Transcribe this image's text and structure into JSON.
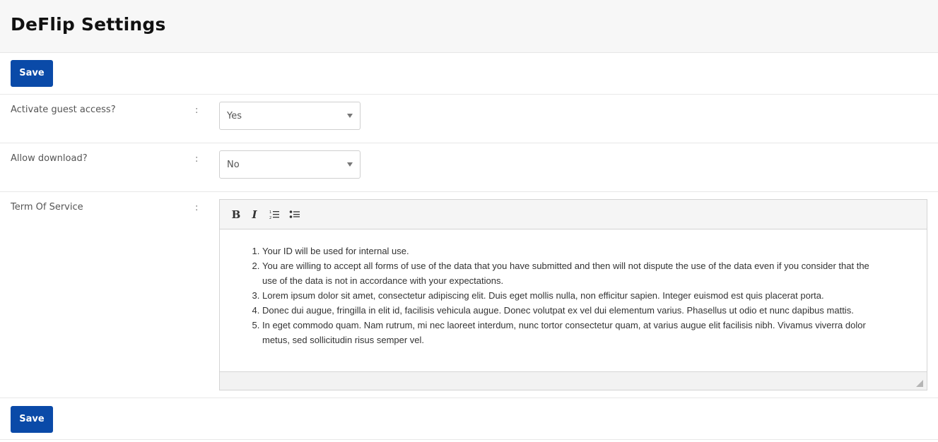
{
  "header": {
    "title": "DeFlip Settings"
  },
  "actions": {
    "save_label": "Save"
  },
  "fields": {
    "guest_access": {
      "label": "Activate guest access?",
      "separator": ":",
      "value": "Yes"
    },
    "allow_download": {
      "label": "Allow download?",
      "separator": ":",
      "value": "No"
    },
    "terms": {
      "label": "Term Of Service",
      "separator": ":"
    }
  },
  "editor": {
    "toolbar": {
      "bold": "B",
      "italic": "I",
      "ordered_list_icon": "ordered-list-icon",
      "bullet_list_icon": "bullet-list-icon"
    },
    "items": [
      "Your ID will be used for internal use.",
      "You are willing to accept all forms of use of the data that you have submitted and then will not dispute the use of the data even if you consider that the use of the data is not in accordance with your expectations.",
      "Lorem ipsum dolor sit amet, consectetur adipiscing elit. Duis eget mollis nulla, non efficitur sapien. Integer euismod est quis placerat porta.",
      "Donec dui augue, fringilla in elit id, facilisis vehicula augue. Donec volutpat ex vel dui elementum varius. Phasellus ut odio et nunc dapibus mattis.",
      "In eget commodo quam. Nam rutrum, mi nec laoreet interdum, nunc tortor consectetur quam, at varius augue elit facilisis nibh. Vivamus viverra dolor metus, sed sollicitudin risus semper vel."
    ]
  },
  "colors": {
    "primary": "#0a4aa8",
    "header_bg": "#f7f7f7"
  }
}
